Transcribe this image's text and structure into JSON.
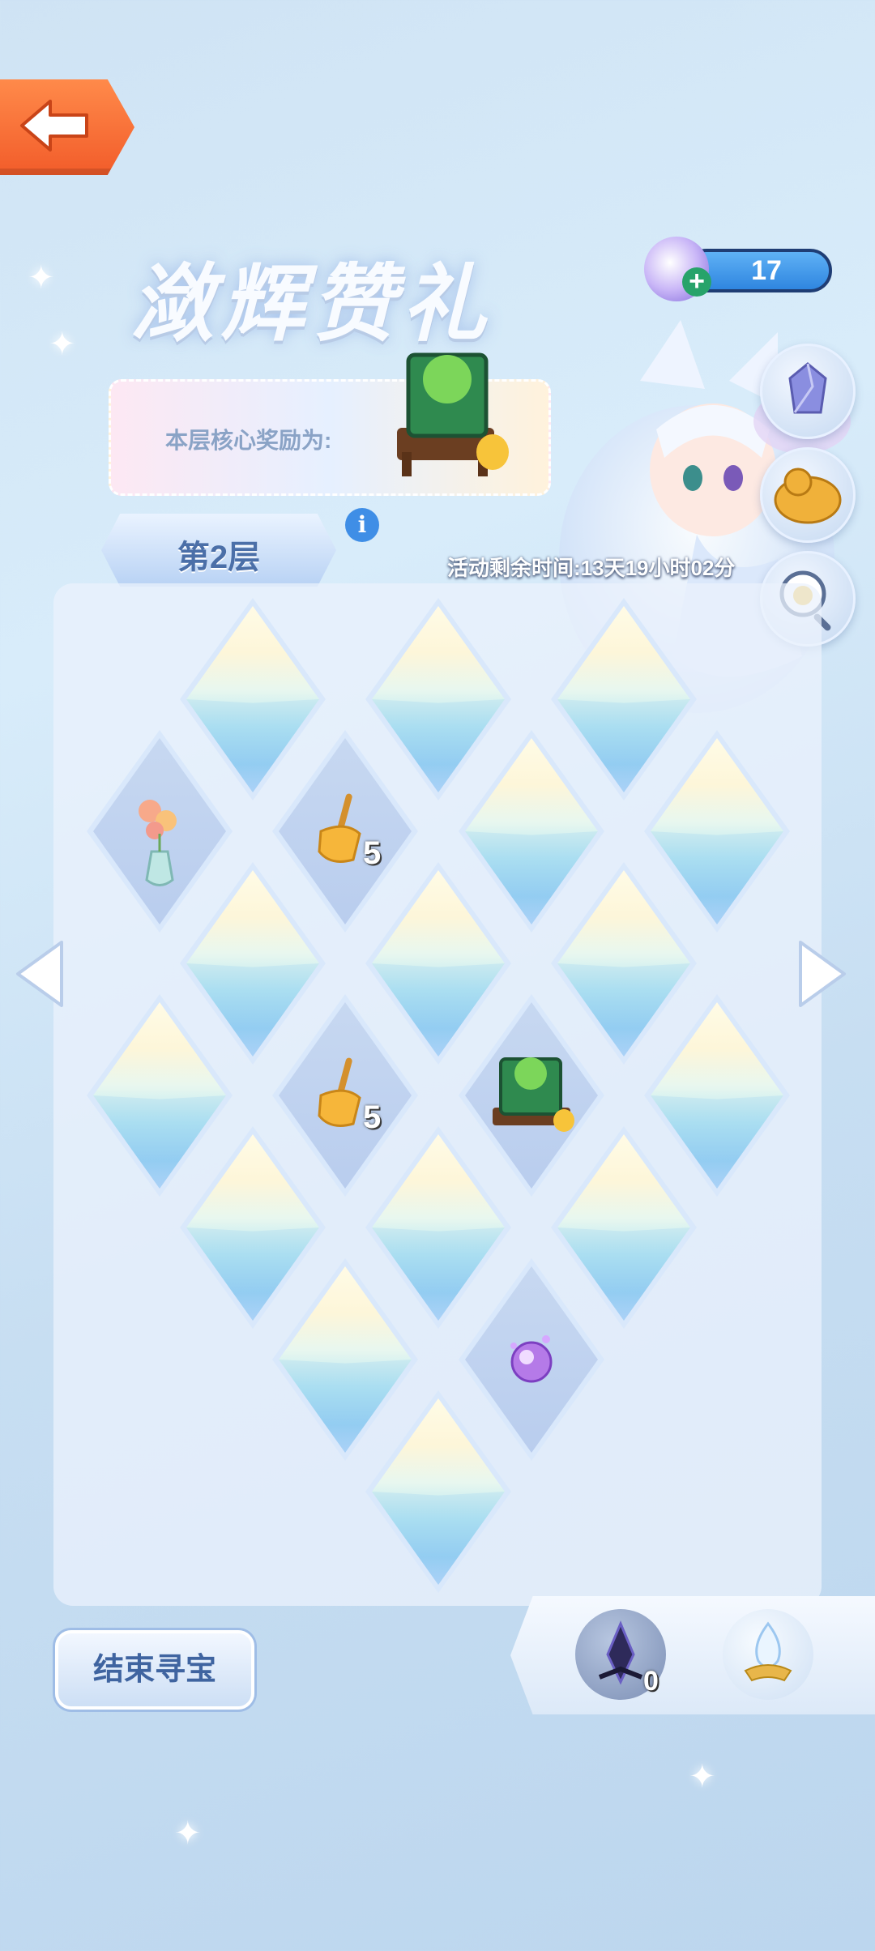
{
  "title": "潋辉赞礼",
  "currency": {
    "amount": "17",
    "plus_label": "+"
  },
  "core_reward": {
    "label": "本层核心奖励为:"
  },
  "floor": {
    "label": "第2层",
    "info_label": "i"
  },
  "timer": "活动剩余时间:13天19小时02分",
  "board_items": {
    "broom_qty_1": "5",
    "broom_qty_2": "5"
  },
  "bottom": {
    "end_button": "结束寻宝",
    "dark_crystal_qty": "0"
  },
  "icons": [
    "back-arrow-icon",
    "currency-orb-icon",
    "crystal-box-icon",
    "golden-cat-icon",
    "magnifier-duck-icon",
    "flower-vase-icon",
    "broom-icon",
    "green-cube-icon",
    "purple-orb-icon",
    "dark-crystal-icon",
    "light-crystal-icon"
  ],
  "colors": {
    "back_button": "#f25c2a",
    "currency_bar": "#2f86e0",
    "text_blue": "#3f64a0"
  }
}
